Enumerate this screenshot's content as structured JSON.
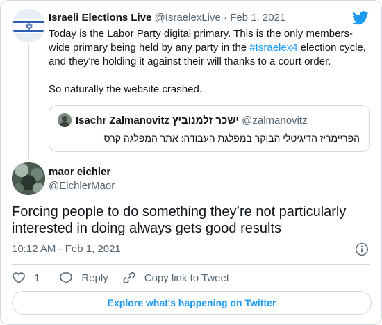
{
  "parent_tweet": {
    "author_name": "Israeli Elections Live",
    "author_handle": "@IsraelexLive",
    "separator": "·",
    "date": "Feb 1, 2021",
    "text_line_1_before": "Today is the Labor Party digital primary. This is the only members-wide primary being held by any party in the ",
    "hashtag": "#Israelex4",
    "text_line_1_after": " election cycle, and they're holding it against their will thanks to a court order.",
    "text_line_2": "So naturally the website crashed."
  },
  "quoted_tweet": {
    "author_name": "Isachr Zalmanovitz ישכר זלמנוביץ",
    "author_handle": "@zalmanovitz",
    "text": "הפריימריז הדיגיטלי הבוקר במפלגת העבודה: אתר המפלגה קרס"
  },
  "main_tweet": {
    "author_name": "maor eichler",
    "author_handle": "@EichlerMaor",
    "text": "Forcing people to do something they’re not particularly interested in doing always gets good results",
    "timestamp": "10:12 AM · Feb 1, 2021"
  },
  "actions": {
    "like_count": "1",
    "reply_label": "Reply",
    "copy_link_label": "Copy link to Tweet"
  },
  "footer": {
    "explore_label": "Explore what's happening on Twitter"
  },
  "colors": {
    "accent": "#1d9bf0",
    "text": "#0f1419",
    "secondary": "#536471",
    "border": "#cfd9de"
  },
  "icons": [
    "twitter-bird-icon",
    "info-icon",
    "heart-icon",
    "reply-icon",
    "link-icon"
  ]
}
